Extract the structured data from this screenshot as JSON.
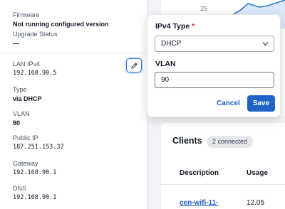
{
  "details": {
    "firmware": {
      "label": "Firmware",
      "value": "Not running configured version"
    },
    "upgrade_status": {
      "label": "Upgrade Status",
      "value": "—"
    },
    "lan_ipv4": {
      "label": "LAN IPv4",
      "value": "192.168.90.5"
    },
    "type": {
      "label": "Type",
      "value": "via DHCP"
    },
    "vlan": {
      "label": "VLAN",
      "value": "90"
    },
    "public_ip": {
      "label": "Public IP",
      "value": "187.251.153.37"
    },
    "gateway": {
      "label": "Gateway",
      "value": "192.168.90.1"
    },
    "dns": {
      "label": "DNS",
      "value": "192.168.90.1"
    }
  },
  "popover": {
    "ipv4_type_label": "IPv4 Type",
    "required_mark": "*",
    "ipv4_type_selected": "DHCP",
    "vlan_label": "VLAN",
    "vlan_value": "90",
    "cancel_label": "Cancel",
    "save_label": "Save"
  },
  "chart": {
    "tick_label": "25"
  },
  "clients": {
    "title": "Clients",
    "badge": "2 connected",
    "columns": [
      "Description",
      "Usage"
    ],
    "first_row": {
      "description": "cen-wifi-11-",
      "usage": "12.05"
    }
  },
  "colors": {
    "accent": "#2163c7",
    "link": "#1f5fc6",
    "required": "#dc2626"
  },
  "icons": {
    "edit": "pencil-icon",
    "select": "chevron-down-icon"
  }
}
